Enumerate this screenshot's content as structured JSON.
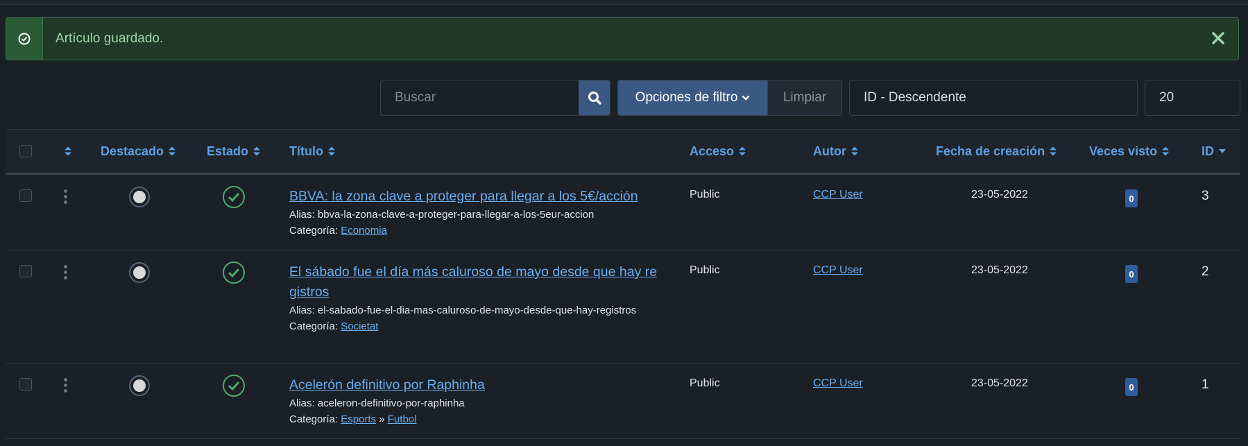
{
  "alert": {
    "message": "Artículo guardado.",
    "icon": "check-circle-icon",
    "close_icon": "close-icon"
  },
  "toolbar": {
    "search_placeholder": "Buscar",
    "filter_options_label": "Opciones de filtro",
    "clear_label": "Limpiar",
    "sort_value": "ID - Descendente",
    "limit_value": "20"
  },
  "table": {
    "headers": {
      "featured": "Destacado",
      "status": "Estado",
      "title": "Título",
      "access": "Acceso",
      "author": "Autor",
      "created": "Fecha de creación",
      "hits": "Veces visto",
      "id": "ID"
    },
    "alias_prefix": "Alias: ",
    "category_prefix": "Categoría: ",
    "rows": [
      {
        "title": "BBVA: la zona clave a proteger para llegar a los 5€/acción",
        "alias": "bbva-la-zona-clave-a-proteger-para-llegar-a-los-5eur-accion",
        "category": "Economia",
        "access": "Public",
        "author": "CCP User",
        "created": "23-05-2022",
        "hits": "0",
        "id": "3"
      },
      {
        "title": "El sábado fue el día más caluroso de mayo desde que hay registros",
        "alias": "el-sabado-fue-el-dia-mas-caluroso-de-mayo-desde-que-hay-registros",
        "category": "Societat",
        "access": "Public",
        "author": "CCP User",
        "created": "23-05-2022",
        "hits": "0",
        "id": "2"
      },
      {
        "title": "Acelerón definitivo por Raphinha",
        "alias": "aceleron-definitivo-por-raphinha",
        "category_parent": "Esports",
        "category_separator": "»",
        "category": "Futbol",
        "access": "Public",
        "author": "CCP User",
        "created": "23-05-2022",
        "hits": "0",
        "id": "1"
      }
    ]
  },
  "colors": {
    "accent": "#69acef",
    "success": "#4ea86a",
    "button": "#3b5883"
  }
}
